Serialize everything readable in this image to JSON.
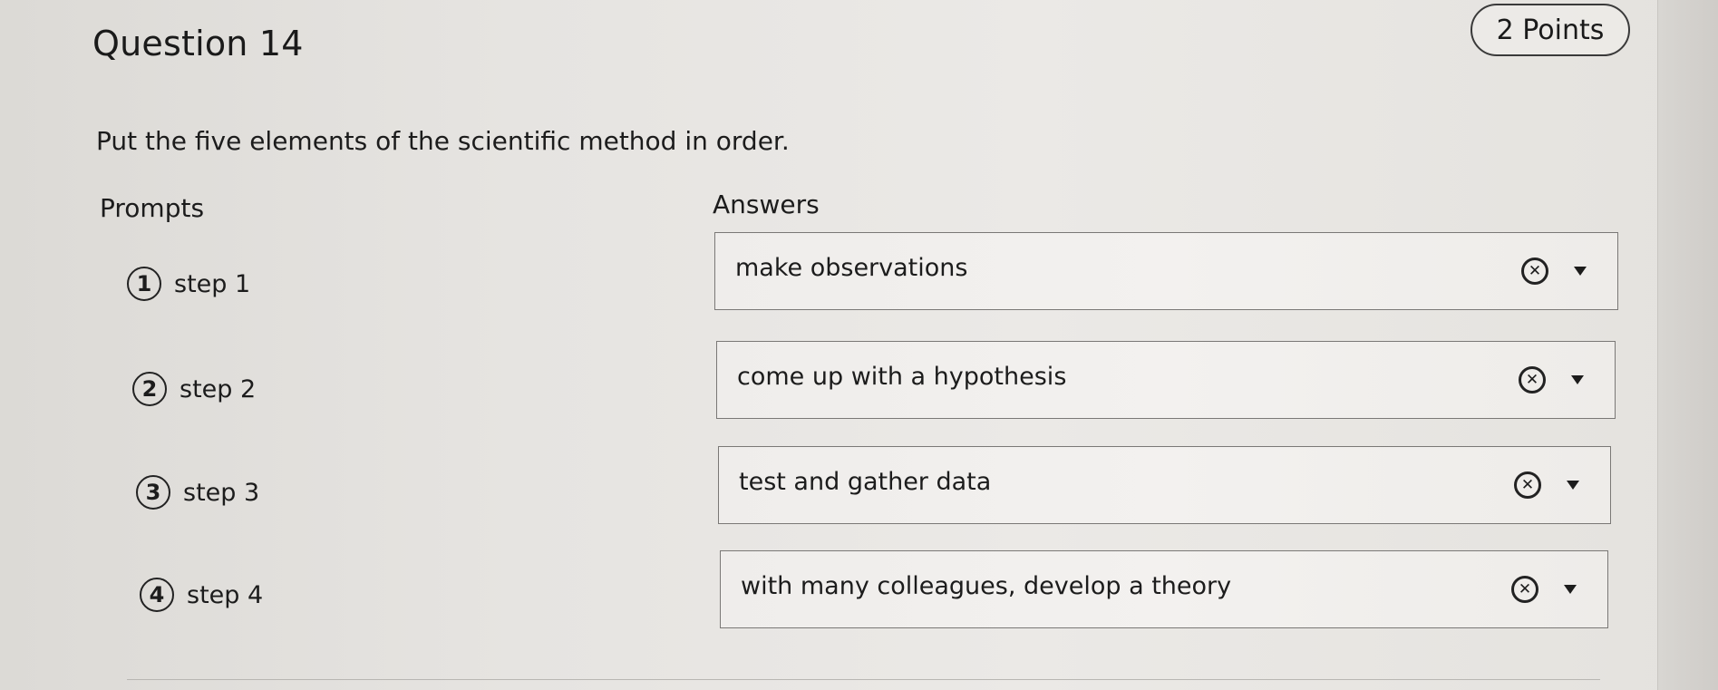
{
  "question": {
    "title": "Question 14",
    "points": "2 Points",
    "instructions": "Put the five elements of the scientific method in order."
  },
  "columns": {
    "prompts": "Prompts",
    "answers": "Answers"
  },
  "prompts": [
    {
      "number": "1",
      "label": "step 1"
    },
    {
      "number": "2",
      "label": "step 2"
    },
    {
      "number": "3",
      "label": "step 3"
    },
    {
      "number": "4",
      "label": "step 4"
    }
  ],
  "answers": [
    {
      "value": "make observations",
      "clear_icon": "clear-circle-x-icon",
      "dropdown_icon": "caret-down-icon"
    },
    {
      "value": "come up with a hypothesis",
      "clear_icon": "clear-circle-x-icon",
      "dropdown_icon": "caret-down-icon"
    },
    {
      "value": "test and gather data",
      "clear_icon": "clear-circle-x-icon",
      "dropdown_icon": "caret-down-icon"
    },
    {
      "value": "with many colleagues, develop a theory",
      "clear_icon": "clear-circle-x-icon",
      "dropdown_icon": "caret-down-icon"
    }
  ]
}
